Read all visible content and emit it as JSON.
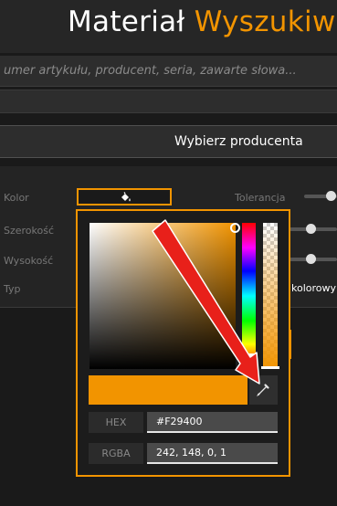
{
  "header": {
    "title_part1": "Materiał",
    "title_part2": "Wyszukiw"
  },
  "search": {
    "placeholder": "umer artykułu, producent, seria, zawarte słowa..."
  },
  "manufacturer": {
    "label": "Wybierz producenta"
  },
  "filters": {
    "color_label": "Kolor",
    "tolerance_label": "Tolerancja",
    "width_label": "Szerokość",
    "height_label": "Wysokość",
    "type_label": "Typ",
    "type_value": "kolorowy"
  },
  "color_picker": {
    "selected_color": "#F29400",
    "hex_label": "HEX",
    "hex_value": "#F29400",
    "rgba_label": "RGBA",
    "rgba_value": "242, 148, 0, 1",
    "hue_position": 0.9,
    "alpha": 1
  },
  "colors": {
    "accent": "#F29400",
    "annotation_arrow": "#E8201A"
  },
  "icons": {
    "color_button": "paint-bucket-icon",
    "eyedropper": "eyedropper-icon"
  }
}
